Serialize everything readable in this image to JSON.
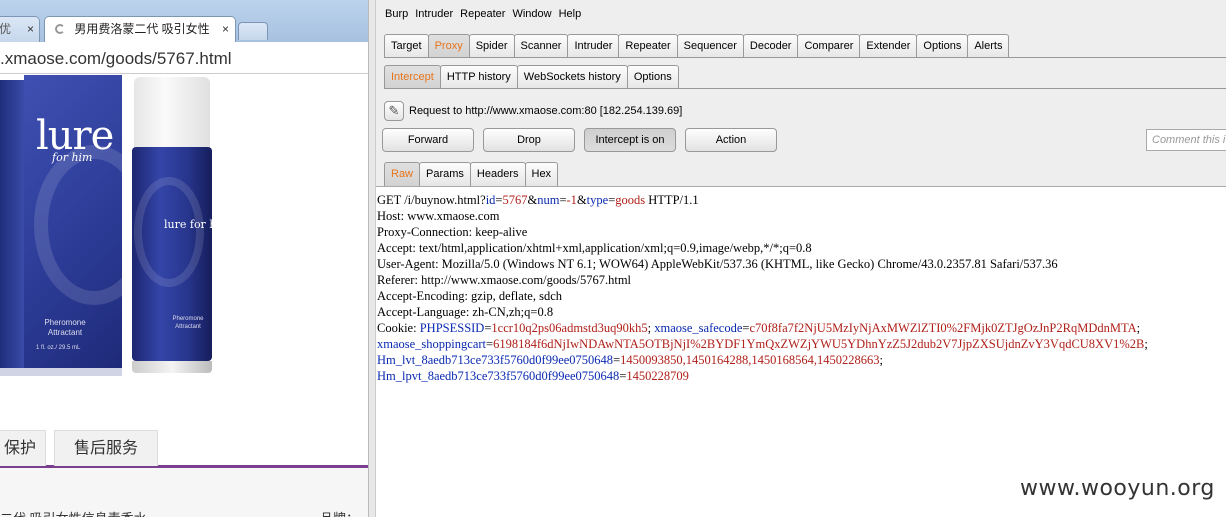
{
  "browser": {
    "tab_inactive_label": "优",
    "tab_active_label": "男用费洛蒙二代 吸引女性",
    "tab_close": "×",
    "url": ".xmaose.com/goods/5767.html",
    "product": {
      "box_logo": "lure",
      "box_sub": "for him",
      "box_pheromone": "Pheromone Attractant",
      "box_volume": "1 fl. oz./ 29.5 mL",
      "bottle_logo": "lure for him",
      "bottle_pheromone": "Pheromone Attractant"
    },
    "tabs": {
      "protect": "保护",
      "service": "售后服务"
    },
    "bottom_name": "二代 吸引女性信息素香水",
    "bottom_brand": "品牌："
  },
  "burp": {
    "menu": [
      "Burp",
      "Intruder",
      "Repeater",
      "Window",
      "Help"
    ],
    "main_tabs": [
      "Target",
      "Proxy",
      "Spider",
      "Scanner",
      "Intruder",
      "Repeater",
      "Sequencer",
      "Decoder",
      "Comparer",
      "Extender",
      "Options",
      "Alerts"
    ],
    "main_tab_active": "Proxy",
    "sub_tabs": [
      "Intercept",
      "HTTP history",
      "WebSockets history",
      "Options"
    ],
    "sub_tab_active": "Intercept",
    "request_target": "Request to http://www.xmaose.com:80  [182.254.139.69]",
    "buttons": {
      "forward": "Forward",
      "drop": "Drop",
      "intercept": "Intercept is on",
      "action": "Action"
    },
    "comment_placeholder": "Comment this item",
    "view_tabs": [
      "Raw",
      "Params",
      "Headers",
      "Hex"
    ],
    "view_tab_active": "Raw",
    "request_lines": [
      "GET /i/buynow.html?id=5767&num=-1&type=goods HTTP/1.1",
      "Host: www.xmaose.com",
      "Proxy-Connection: keep-alive",
      "Accept: text/html,application/xhtml+xml,application/xml;q=0.9,image/webp,*/*;q=0.8",
      "User-Agent: Mozilla/5.0 (Windows NT 6.1; WOW64) AppleWebKit/537.36 (KHTML, like Gecko) Chrome/43.0.2357.81 Safari/537.36",
      "Referer: http://www.xmaose.com/goods/5767.html",
      "Accept-Encoding: gzip, deflate, sdch",
      "Accept-Language: zh-CN,zh;q=0.8"
    ],
    "cookie_lines": [
      [
        [
          "",
          "Cookie: "
        ],
        [
          "k",
          "PHPSESSID"
        ],
        [
          "",
          "="
        ],
        [
          "v",
          "1ccr10q2ps06admstd3uq90kh5"
        ],
        [
          "",
          "; "
        ],
        [
          "k",
          "xmaose_safecode"
        ],
        [
          "",
          "="
        ],
        [
          "v",
          "c70f8fa7f2NjU5MzIyNjAxMWZlZTI0%2FMjk0ZTJgOzJnP2RqMDdnMTA"
        ],
        [
          "",
          ";"
        ]
      ],
      [
        [
          "k",
          "xmaose_shoppingcart"
        ],
        [
          "",
          "="
        ],
        [
          "v",
          "6198184f6dNjIwNDAwNTA5OTBjNjI%2BYDF1YmQxZWZjYWU5YDhnYzZ5J2dub2V7JjpZXSUjdnZvY3VqdCU8XV1%2B"
        ],
        [
          "",
          ";"
        ]
      ],
      [
        [
          "k",
          "Hm_lvt_8aedb713ce733f5760d0f99ee0750648"
        ],
        [
          "",
          "="
        ],
        [
          "v",
          "1450093850,1450164288,1450168564,1450228663"
        ],
        [
          "",
          ";"
        ]
      ],
      [
        [
          "k",
          "Hm_lpvt_8aedb713ce733f5760d0f99ee0750648"
        ],
        [
          "",
          "="
        ],
        [
          "v",
          "1450228709"
        ]
      ]
    ]
  },
  "watermark": "www.wooyun.org"
}
